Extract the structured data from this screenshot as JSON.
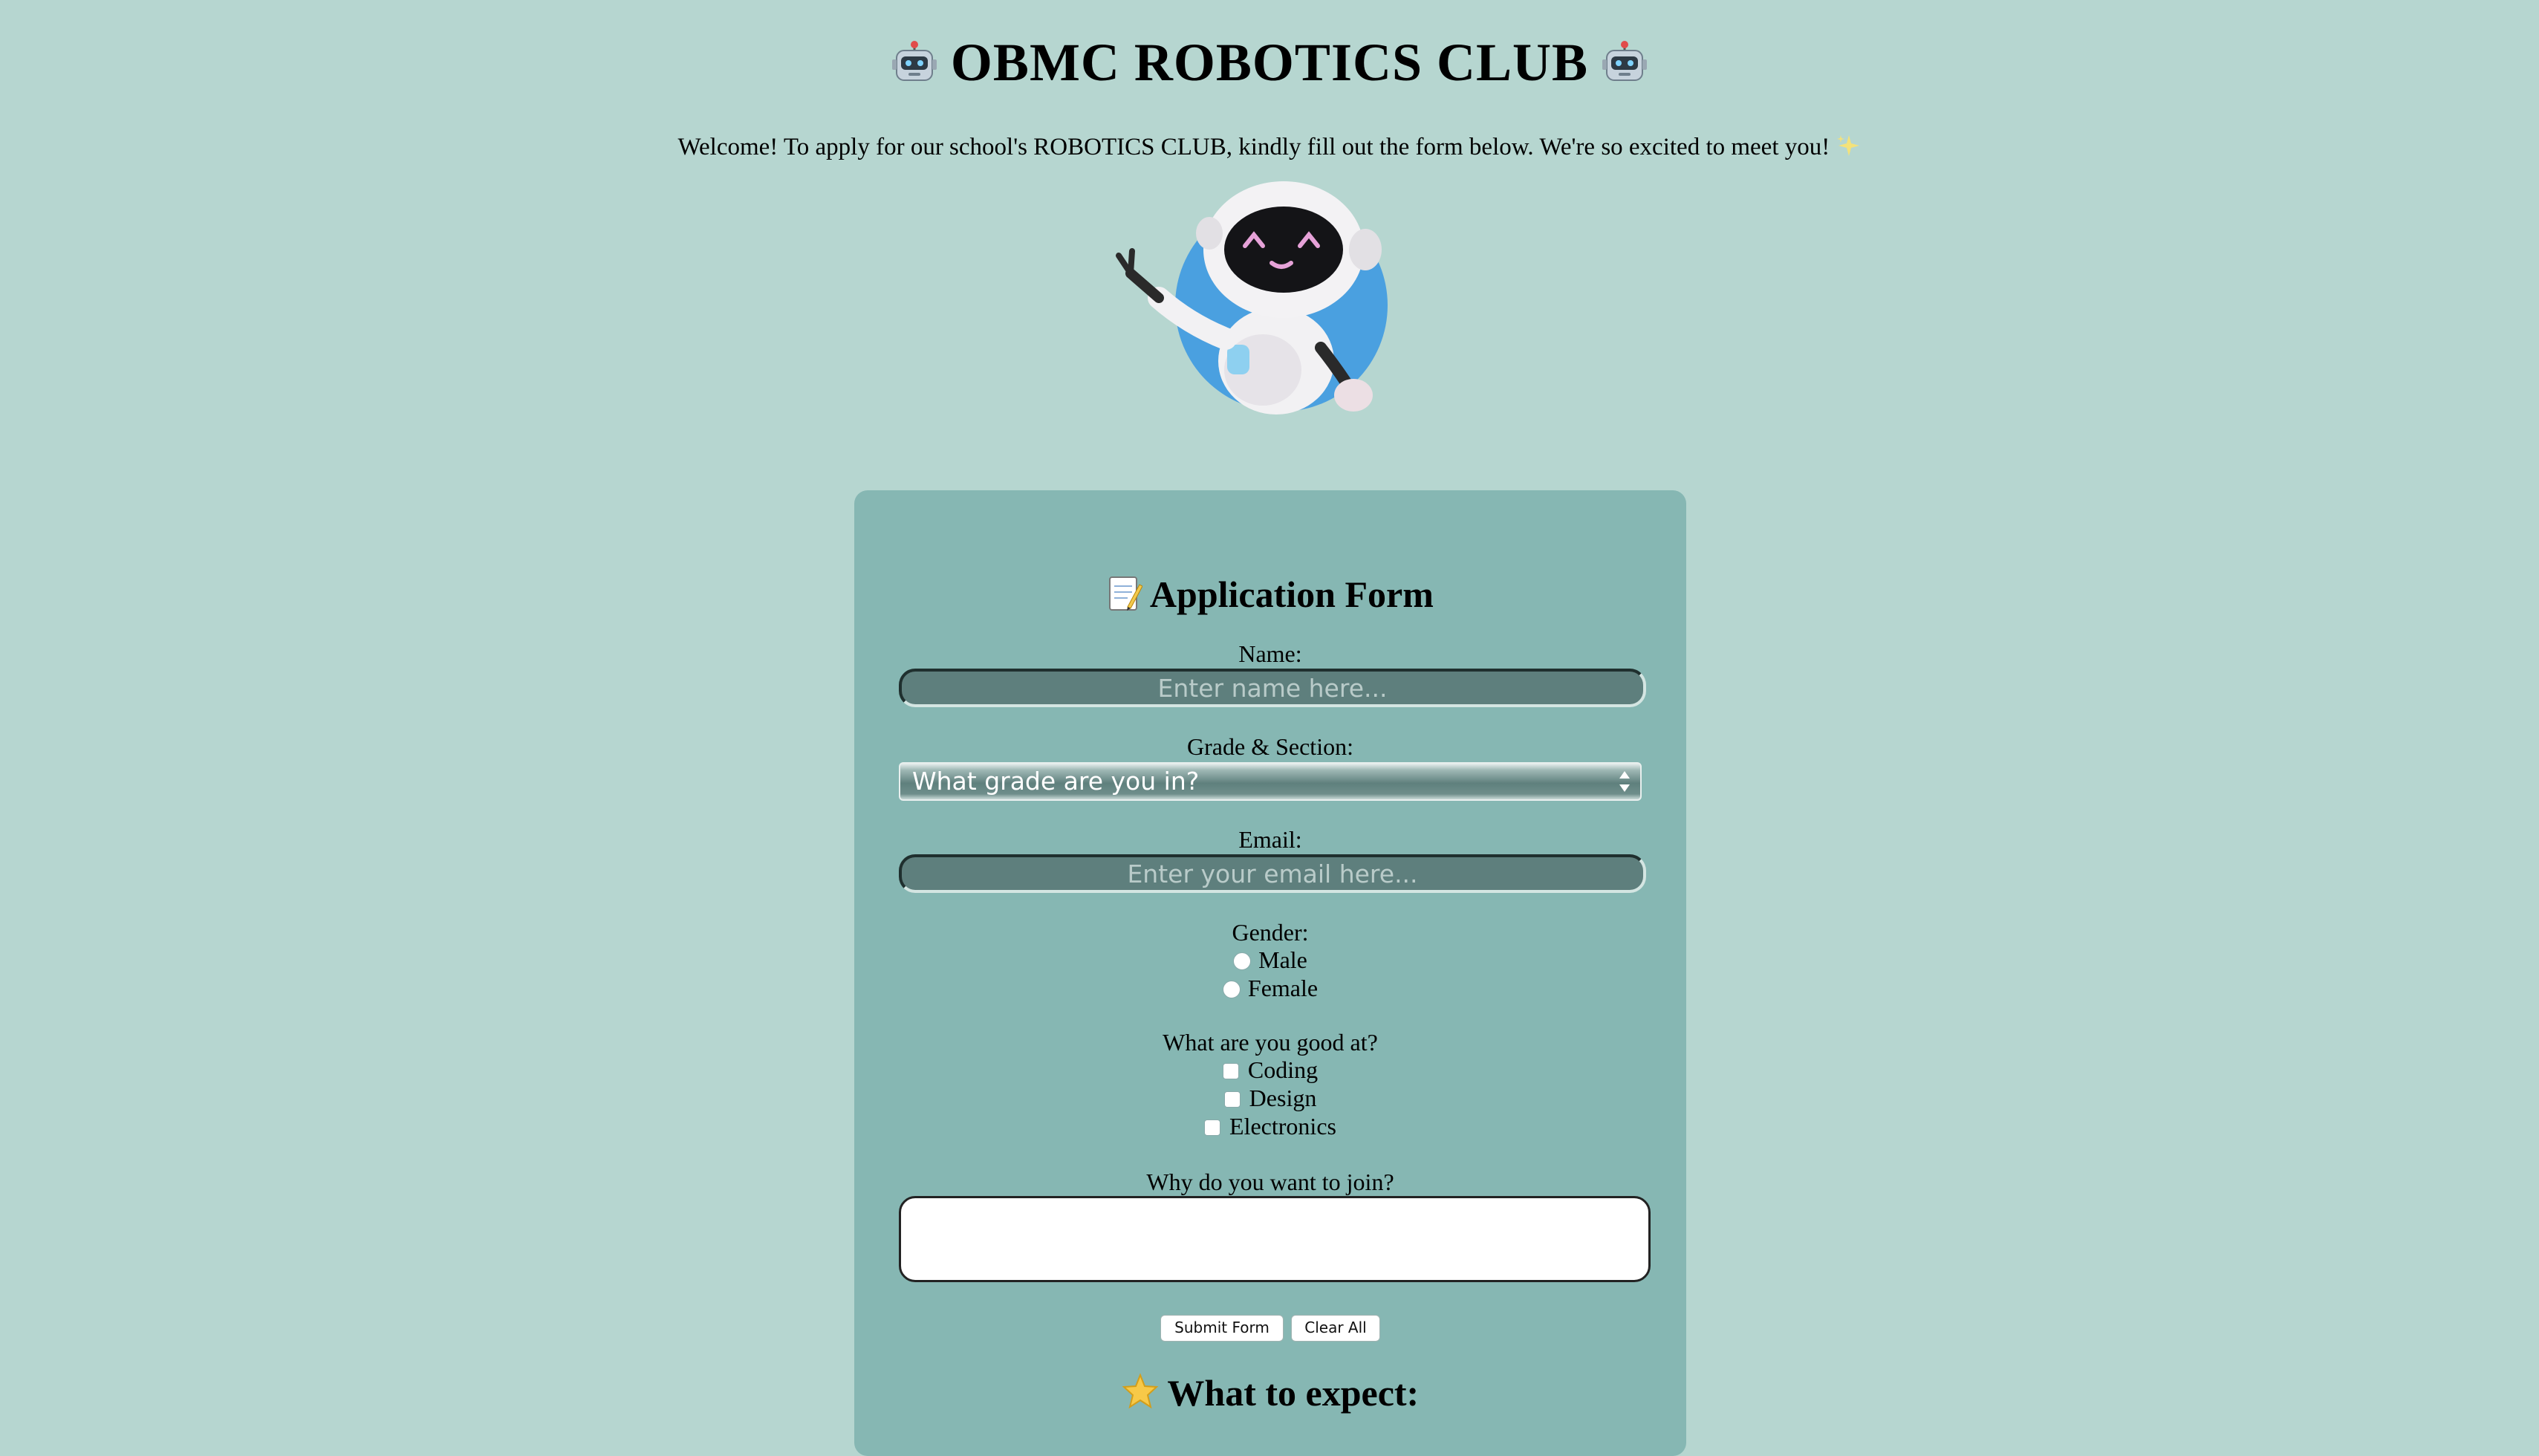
{
  "header": {
    "title": "OBMC ROBOTICS CLUB",
    "title_icon": "robot-face",
    "welcome": "Welcome! To apply for our school's ROBOTICS CLUB, kindly fill out the form below. We're so excited to meet you!",
    "welcome_icon": "sparkles"
  },
  "form": {
    "heading": "Application Form",
    "heading_icon": "memo",
    "name_label": "Name:",
    "name_placeholder": "Enter name here...",
    "grade_label": "Grade & Section:",
    "grade_selected": "What grade are you in?",
    "email_label": "Email:",
    "email_placeholder": "Enter your email here...",
    "gender_label": "Gender:",
    "gender_options": [
      "Male",
      "Female"
    ],
    "skills_label": "What are you good at?",
    "skills_options": [
      "Coding",
      "Design",
      "Electronics"
    ],
    "why_label": "Why do you want to join?",
    "submit_label": "Submit Form",
    "clear_label": "Clear All",
    "expect_heading": "What to expect:",
    "expect_icon": "star"
  },
  "colors": {
    "page_bg": "#b6d6d0",
    "card_bg": "#86b7b3",
    "input_bg": "#5e7f7d",
    "mascot_circle": "#4aa0e0"
  }
}
